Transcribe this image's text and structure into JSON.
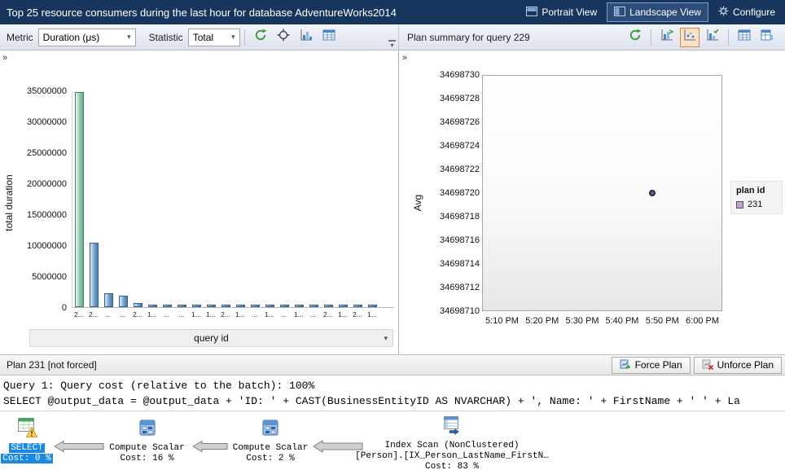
{
  "colors": {
    "titlebar_bg": "#17365d",
    "selection_blue": "#1989e4",
    "bar_fill": "#6f9dc8",
    "bar_selected_fill": "#8cc7ab",
    "point_fill": "#5f6b96",
    "legend_swatch": "#b9a7c9",
    "checked_button_border": "#e0833a"
  },
  "icons": {
    "refresh-icon": "circular green arrows",
    "track-query-icon": "crosshair circle",
    "view-chart-icon": "bar chart glyph",
    "view-grid-icon": "table glyph",
    "chevron-down-icon": "▾",
    "collapse-panel-icon": "»",
    "warning-icon": "yellow triangle !"
  },
  "title_bar": {
    "title": "Top 25 resource consumers during the last hour for database AdventureWorks2014",
    "portrait_button": "Portrait View",
    "landscape_button": "Landscape View",
    "configure_button": "Configure"
  },
  "toolbar": {
    "metric_label": "Metric",
    "metric_value": "Duration (μs)",
    "statistic_label": "Statistic",
    "statistic_value": "Total",
    "plan_summary_title": "Plan summary for query 229"
  },
  "chart_data": [
    {
      "type": "bar",
      "title": "",
      "xlabel": "query id",
      "ylabel": "total duration",
      "ylim": [
        0,
        35000000
      ],
      "grid": false,
      "yticks": [
        "35000000",
        "30000000",
        "25000000",
        "20000000",
        "15000000",
        "10000000",
        "5000000",
        "0"
      ],
      "categories": [
        "2...",
        "2...",
        "...",
        "...",
        "2...",
        "1...",
        "...",
        "...",
        "1...",
        "1...",
        "2...",
        "1...",
        "...",
        "1...",
        "...",
        "1...",
        "...",
        "2...",
        "1...",
        "2...",
        "1..."
      ],
      "values": [
        34698720,
        10400000,
        2300000,
        1900000,
        700000,
        350000,
        310000,
        290000,
        270000,
        250000,
        240000,
        230000,
        220000,
        210000,
        200000,
        190000,
        180000,
        170000,
        160000,
        150000,
        140000
      ],
      "selected_index": 0,
      "selected_query_id": 229
    },
    {
      "type": "scatter",
      "title": "Plan summary for query 229",
      "xlabel": "",
      "ylabel": "Avg",
      "ylim": [
        34698710,
        34698730
      ],
      "grid": false,
      "yticks": [
        "34698730",
        "34698728",
        "34698726",
        "34698724",
        "34698722",
        "34698720",
        "34698718",
        "34698716",
        "34698714",
        "34698712",
        "34698710"
      ],
      "xticks": [
        "5:10 PM",
        "5:20 PM",
        "5:30 PM",
        "5:40 PM",
        "5:50 PM",
        "6:00 PM"
      ],
      "xtick_fracs": [
        0.083,
        0.25,
        0.417,
        0.583,
        0.75,
        0.917
      ],
      "points": [
        {
          "x": "5:47 PM",
          "x_frac": 0.71,
          "y": 34698720,
          "plan_id": "231"
        }
      ],
      "legend": {
        "title": "plan id",
        "items": [
          {
            "label": "231",
            "color": "#b9a7c9"
          }
        ]
      },
      "legend_position": "right"
    }
  ],
  "plan_bar": {
    "label": "Plan 231 [not forced]",
    "force_plan_button": "Force Plan",
    "unforce_plan_button": "Unforce Plan"
  },
  "query_text": {
    "line1": "Query 1: Query cost (relative to the batch): 100%",
    "line2": "SELECT @output_data = @output_data + 'ID: ' + CAST(BusinessEntityID AS NVARCHAR) + ', Name: ' + FirstName + ' ' + La"
  },
  "plan_diagram": {
    "select_node": {
      "line1": "SELECT",
      "line2": "Cost: 0 %"
    },
    "compute_scalar_1": {
      "line1": "Compute Scalar",
      "line2": "Cost: 16 %"
    },
    "compute_scalar_2": {
      "line1": "Compute Scalar",
      "line2": "Cost: 2 %"
    },
    "index_scan": {
      "line1": "Index Scan (NonClustered)",
      "line2": "[Person].[IX_Person_LastName_FirstN…",
      "line3": "Cost: 83 %"
    }
  }
}
